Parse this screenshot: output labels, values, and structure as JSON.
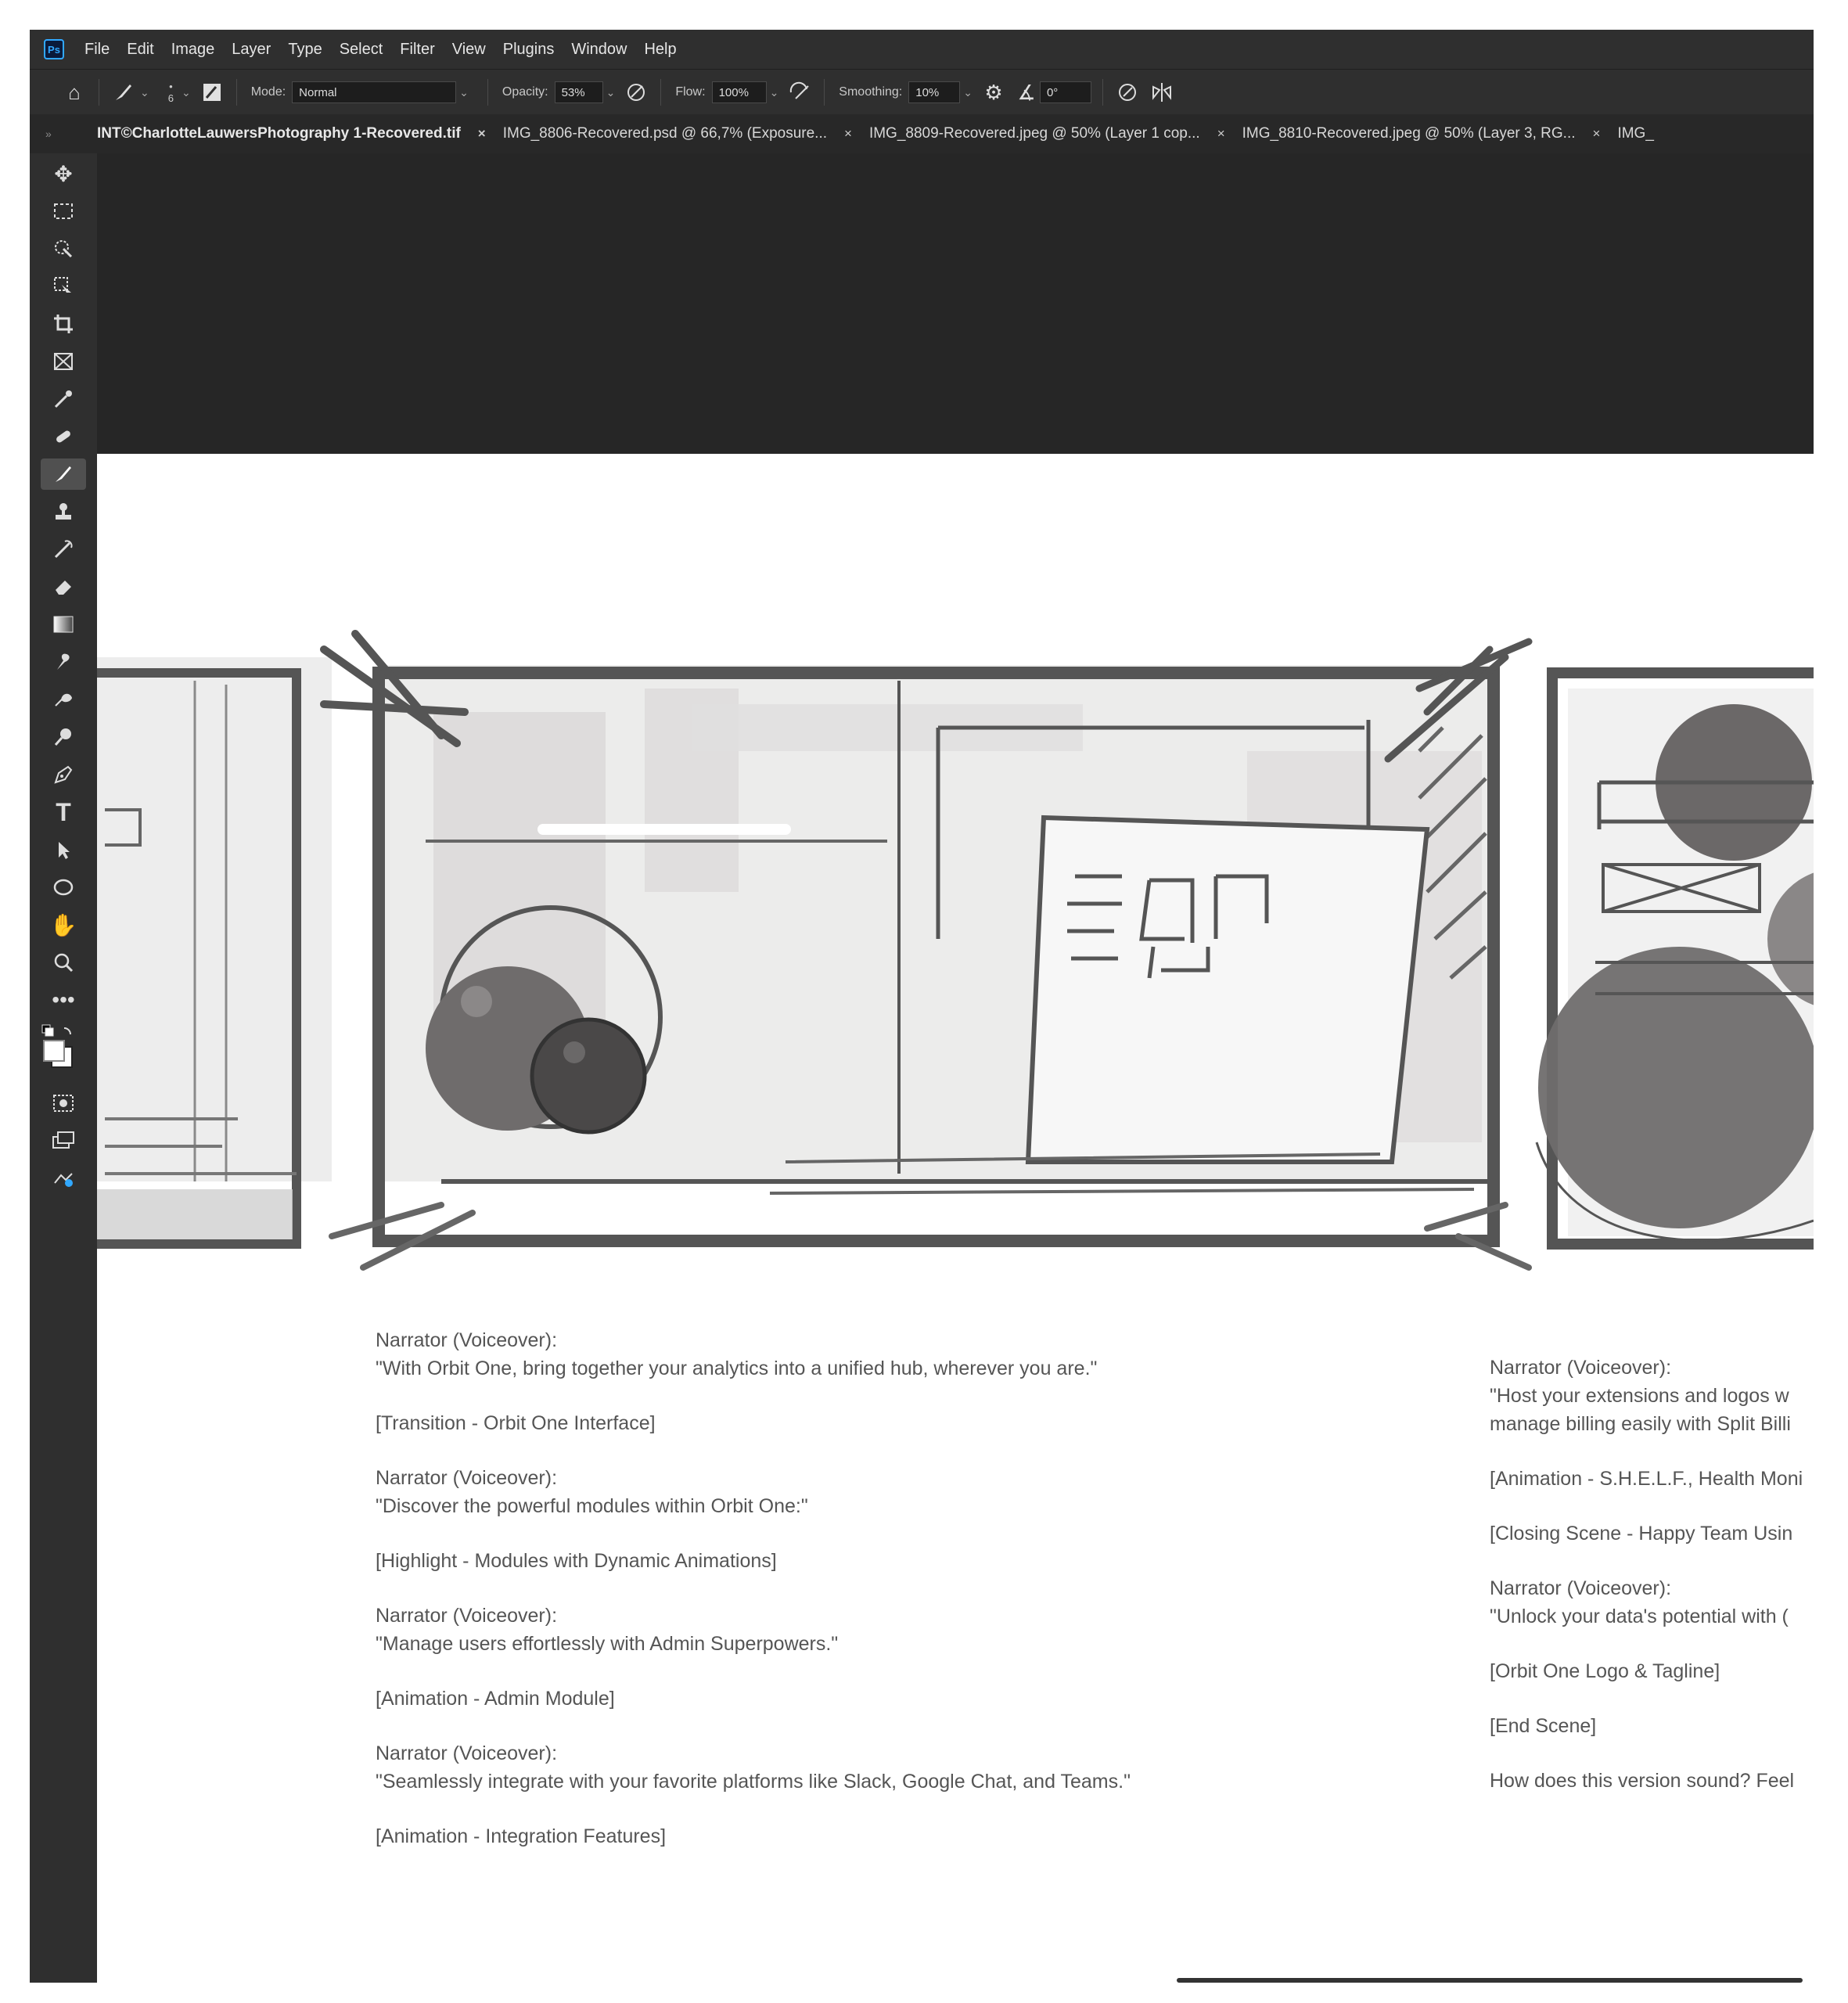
{
  "app": {
    "name": "Ps"
  },
  "menu": [
    "File",
    "Edit",
    "Image",
    "Layer",
    "Type",
    "Select",
    "Filter",
    "View",
    "Plugins",
    "Window",
    "Help"
  ],
  "options": {
    "brush_size": "6",
    "mode_label": "Mode:",
    "mode_value": "Normal",
    "opacity_label": "Opacity:",
    "opacity_value": "53%",
    "flow_label": "Flow:",
    "flow_value": "100%",
    "smoothing_label": "Smoothing:",
    "smoothing_value": "10%",
    "angle_value": "0°"
  },
  "tabs": [
    {
      "label": "INT©CharlotteLauwersPhotography 1-Recovered.tif",
      "close": "×"
    },
    {
      "label": "IMG_8806-Recovered.psd @ 66,7% (Exposure...",
      "close": "×"
    },
    {
      "label": "IMG_8809-Recovered.jpeg @ 50% (Layer 1 cop...",
      "close": "×"
    },
    {
      "label": "IMG_8810-Recovered.jpeg @ 50% (Layer 3, RG...",
      "close": "×"
    },
    {
      "label": "IMG_",
      "close": ""
    }
  ],
  "tools": [
    "move-tool-icon",
    "marquee-tool-icon",
    "quick-selection-tool-icon",
    "object-selection-tool-icon",
    "crop-tool-icon",
    "frame-tool-icon",
    "eyedropper-tool-icon",
    "healing-brush-tool-icon",
    "brush-tool-icon",
    "clone-stamp-tool-icon",
    "history-brush-tool-icon",
    "eraser-tool-icon",
    "gradient-tool-icon",
    "smudge-tool-icon",
    "dodge-tool-icon",
    "burn-tool-icon",
    "pen-tool-icon",
    "type-tool-icon",
    "path-selection-tool-icon",
    "ellipse-tool-icon",
    "hand-tool-icon",
    "zoom-tool-icon",
    "more-tools-icon",
    "color-swatches-icon",
    "quick-mask-icon",
    "screen-mode-icon",
    "generative-fill-icon"
  ],
  "script_left": [
    "Narrator (Voiceover):\n\"With Orbit One, bring together your analytics into a unified hub, wherever you are.\"",
    "[Transition - Orbit One Interface]",
    "Narrator (Voiceover):\n\"Discover the powerful modules within Orbit One:\"",
    "[Highlight - Modules with Dynamic Animations]",
    "Narrator (Voiceover):\n\"Manage users effortlessly with Admin Superpowers.\"",
    "[Animation - Admin Module]",
    "Narrator (Voiceover):\n\"Seamlessly integrate with your favorite platforms like Slack, Google Chat, and Teams.\"",
    "[Animation - Integration Features]"
  ],
  "script_right": [
    "Narrator (Voiceover):\n\"Host your extensions and logos w\nmanage billing easily with Split Billi",
    "[Animation - S.H.E.L.F., Health Moni",
    "[Closing Scene - Happy Team Usin",
    "Narrator (Voiceover):\n\"Unlock your data's potential with (",
    "[Orbit One Logo & Tagline]",
    "[End Scene]",
    "How does this version sound? Feel"
  ],
  "colors": {
    "ui_dark": "#2f2f2f",
    "pasteboard": "#262626",
    "sketch_frame": "#555555",
    "accent": "#31a8ff"
  }
}
